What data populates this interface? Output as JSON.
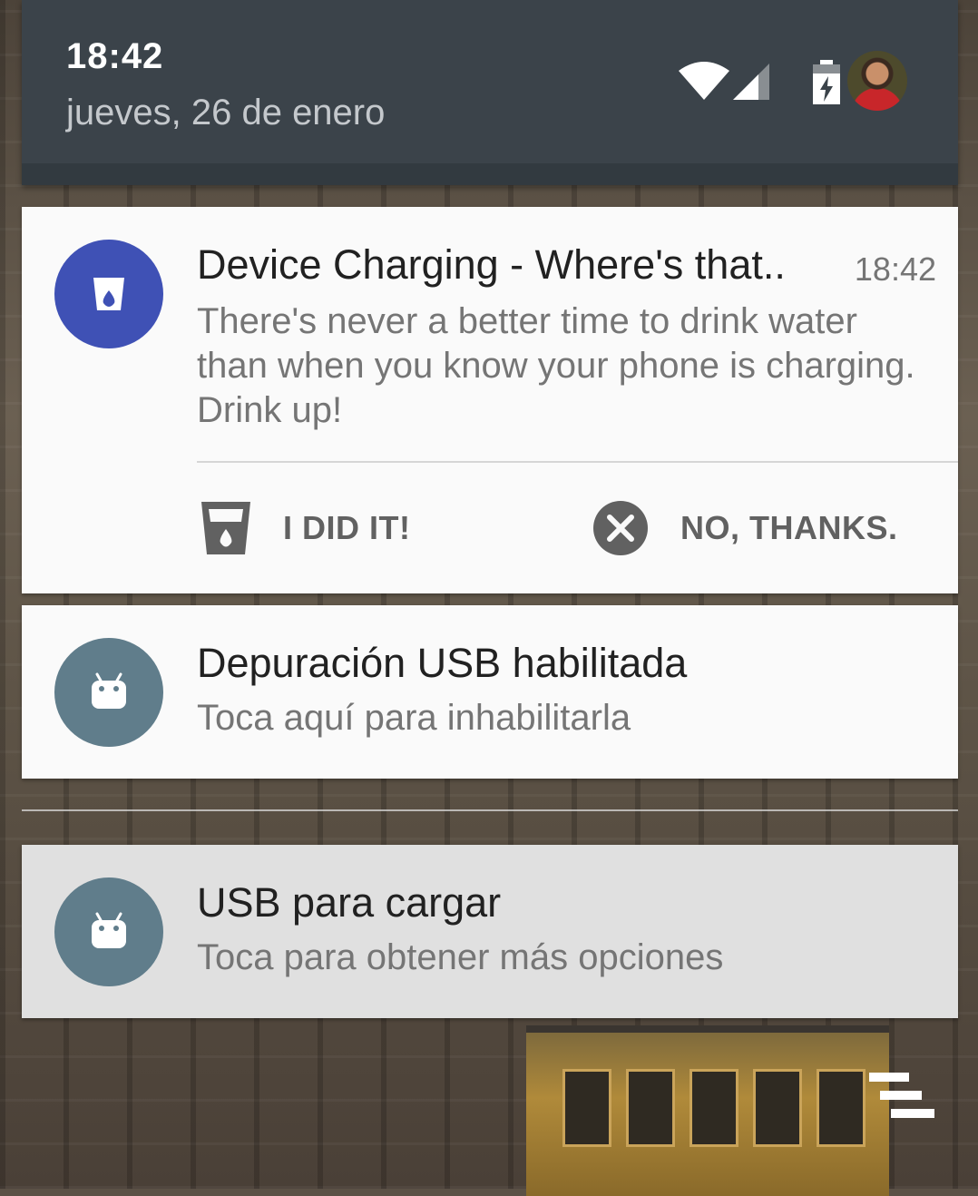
{
  "status_bar": {
    "time": "18:42",
    "date": "jueves, 26 de enero",
    "icons": [
      "wifi-icon",
      "cell-signal-icon",
      "battery-charging-icon",
      "user-avatar"
    ]
  },
  "notifications": [
    {
      "app_icon": "water-cup-icon",
      "app_color": "#3f51b5",
      "title": "Device Charging - Where's that..",
      "time": "18:42",
      "text": "There's never a better time to drink water than when you know your phone is charging. Drink up!",
      "actions": [
        {
          "icon": "water-cup-icon",
          "label": "I DID IT!"
        },
        {
          "icon": "close-circle-icon",
          "label": "NO, THANKS."
        }
      ]
    },
    {
      "app_icon": "android-icon",
      "app_color": "#607d8b",
      "title": "Depuración USB habilitada",
      "text": "Toca aquí para inhabilitarla"
    },
    {
      "app_icon": "android-icon",
      "app_color": "#607d8b",
      "title": "USB para cargar",
      "text": "Toca para obtener más opciones"
    }
  ],
  "overlay": {
    "icon": "clear-all-icon"
  }
}
